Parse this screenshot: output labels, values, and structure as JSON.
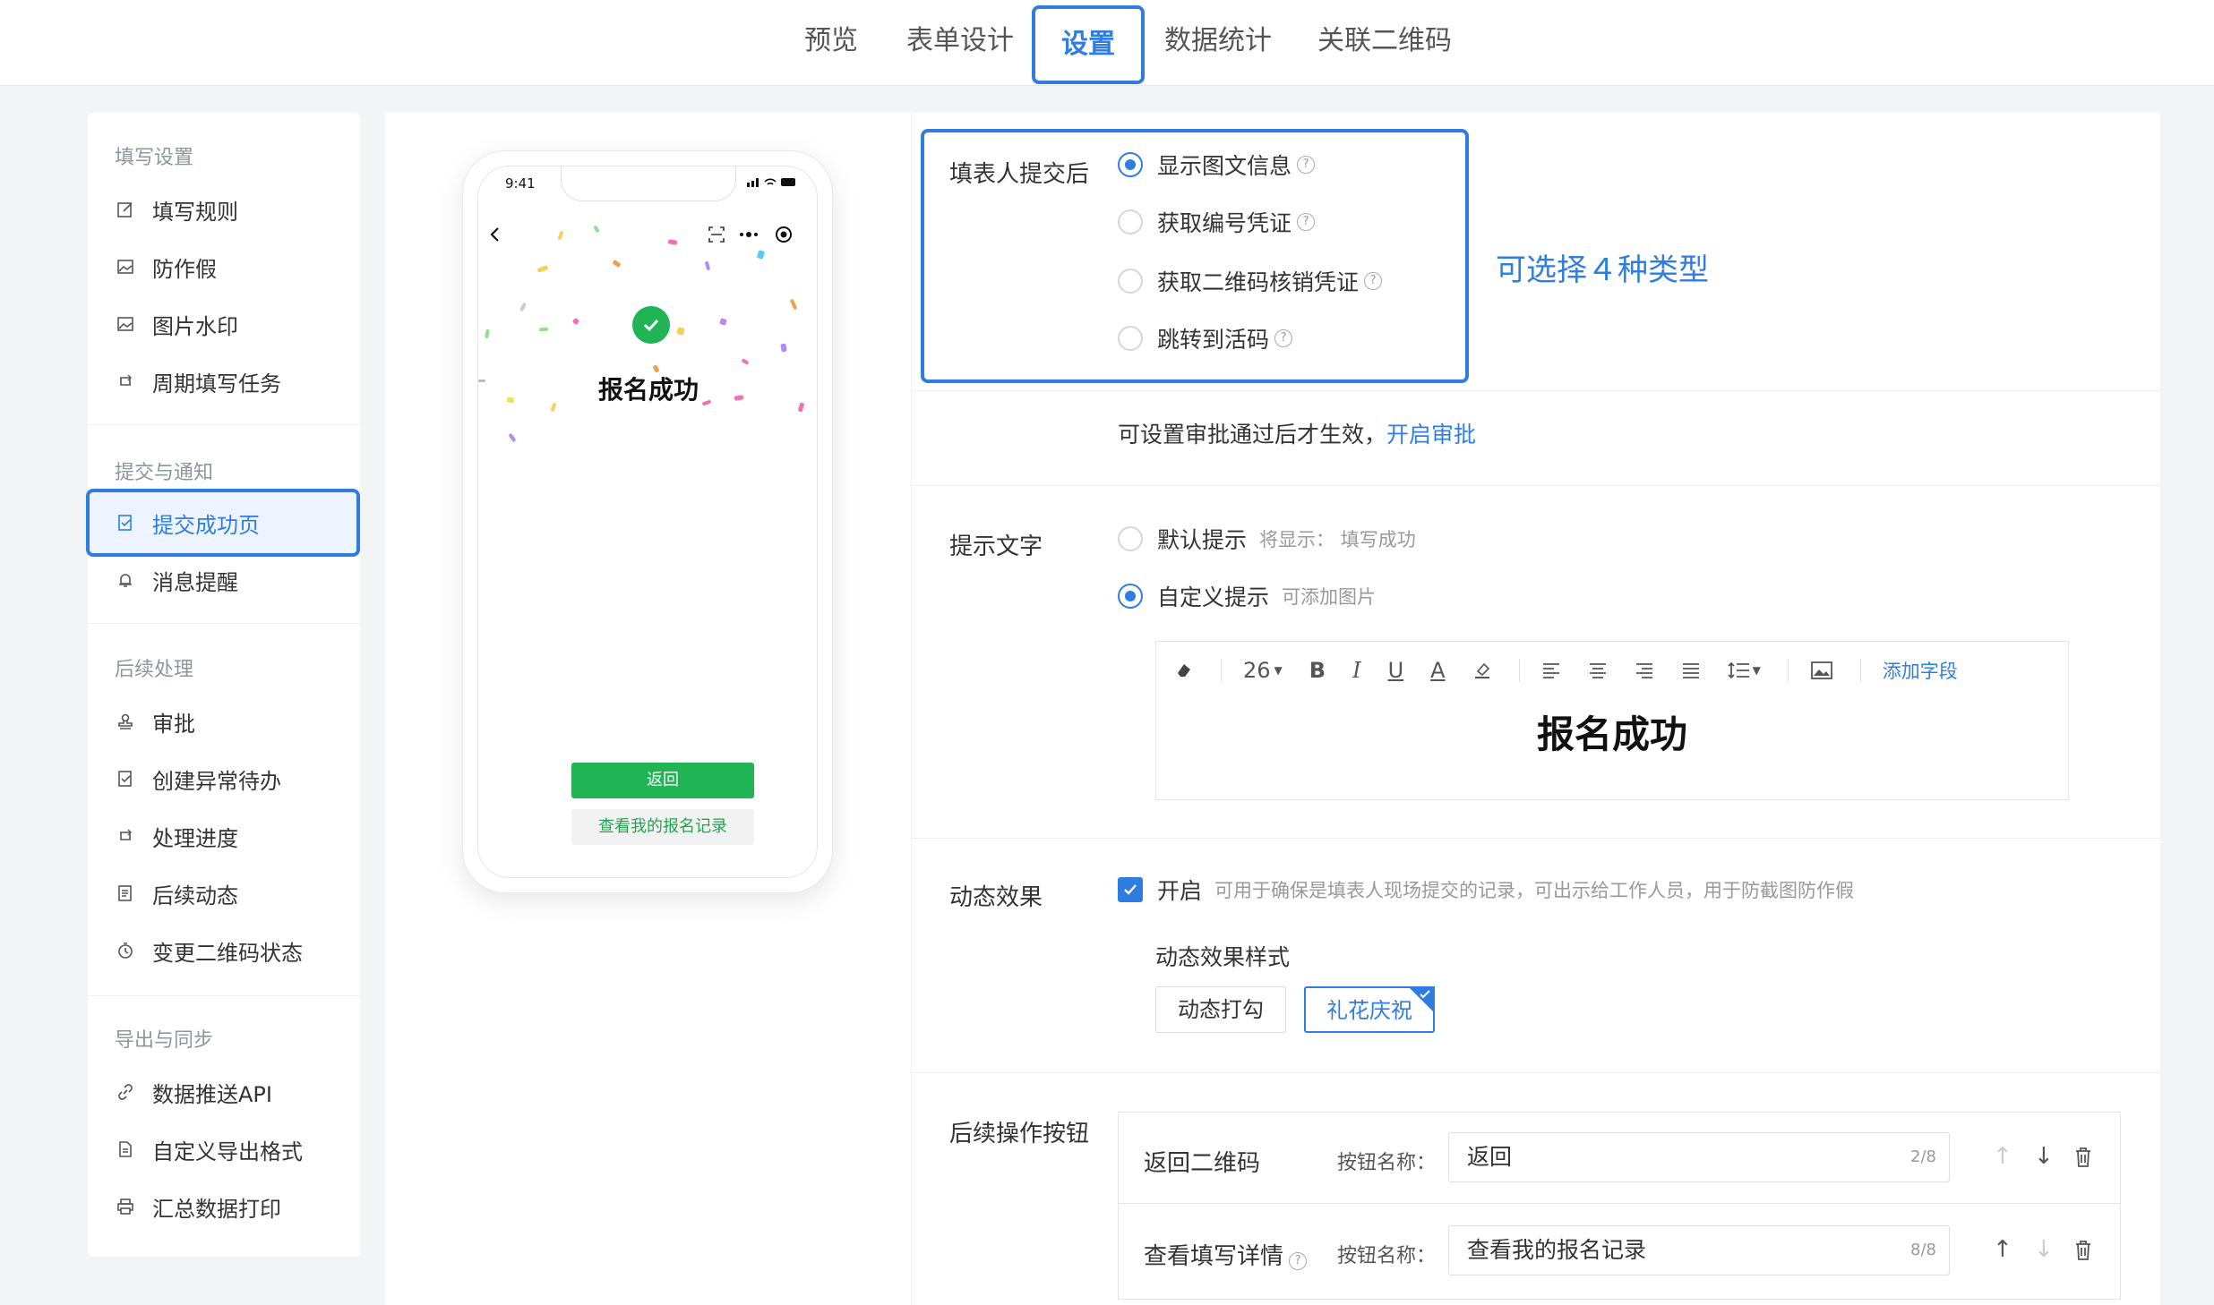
{
  "top_tabs": {
    "preview": "预览",
    "form_design": "表单设计",
    "settings": "设置",
    "stats": "数据统计",
    "qrcode": "关联二维码"
  },
  "sidebar": {
    "group_fill": "填写设置",
    "fill_rules": "填写规则",
    "anti_fake": "防作假",
    "watermark": "图片水印",
    "periodic": "周期填写任务",
    "group_submit": "提交与通知",
    "success_page": "提交成功页",
    "notify": "消息提醒",
    "group_followup": "后续处理",
    "approval": "审批",
    "exception": "创建异常待办",
    "progress": "处理进度",
    "dynamic": "后续动态",
    "change_qr": "变更二维码状态",
    "group_export": "导出与同步",
    "push_api": "数据推送API",
    "export_format": "自定义导出格式",
    "print": "汇总数据打印"
  },
  "phone": {
    "time": "9:41",
    "title": "报名成功",
    "btn_return": "返回",
    "btn_records": "查看我的报名记录"
  },
  "after_submit": {
    "label": "填表人提交后",
    "opt1": "显示图文信息",
    "opt2": "获取编号凭证",
    "opt3": "获取二维码核销凭证",
    "opt4": "跳转到活码",
    "annotation": "可选择４种类型"
  },
  "approval_note": {
    "text": "可设置审批通过后才生效，",
    "link": "开启审批"
  },
  "tip_text": {
    "label": "提示文字",
    "default": "默认提示",
    "default_hint": "将显示： 填写成功",
    "custom": "自定义提示",
    "custom_hint": "可添加图片",
    "font_size": "26",
    "add_field": "添加字段",
    "editor_content": "报名成功"
  },
  "effect": {
    "label": "动态效果",
    "enable": "开启",
    "enable_hint": "可用于确保是填表人现场提交的记录，可出示给工作人员，用于防截图防作假",
    "style_label": "动态效果样式",
    "style1": "动态打勾",
    "style2": "礼花庆祝"
  },
  "followup_buttons": {
    "label": "后续操作按钮",
    "name_label": "按钮名称：",
    "row1_name": "返回二维码",
    "row1_value": "返回",
    "row1_count": "2/8",
    "row2_name": "查看填写详情",
    "row2_value": "查看我的报名记录",
    "row2_count": "8/8"
  },
  "colors": {
    "accent": "#2f7de0",
    "green": "#21b455"
  }
}
